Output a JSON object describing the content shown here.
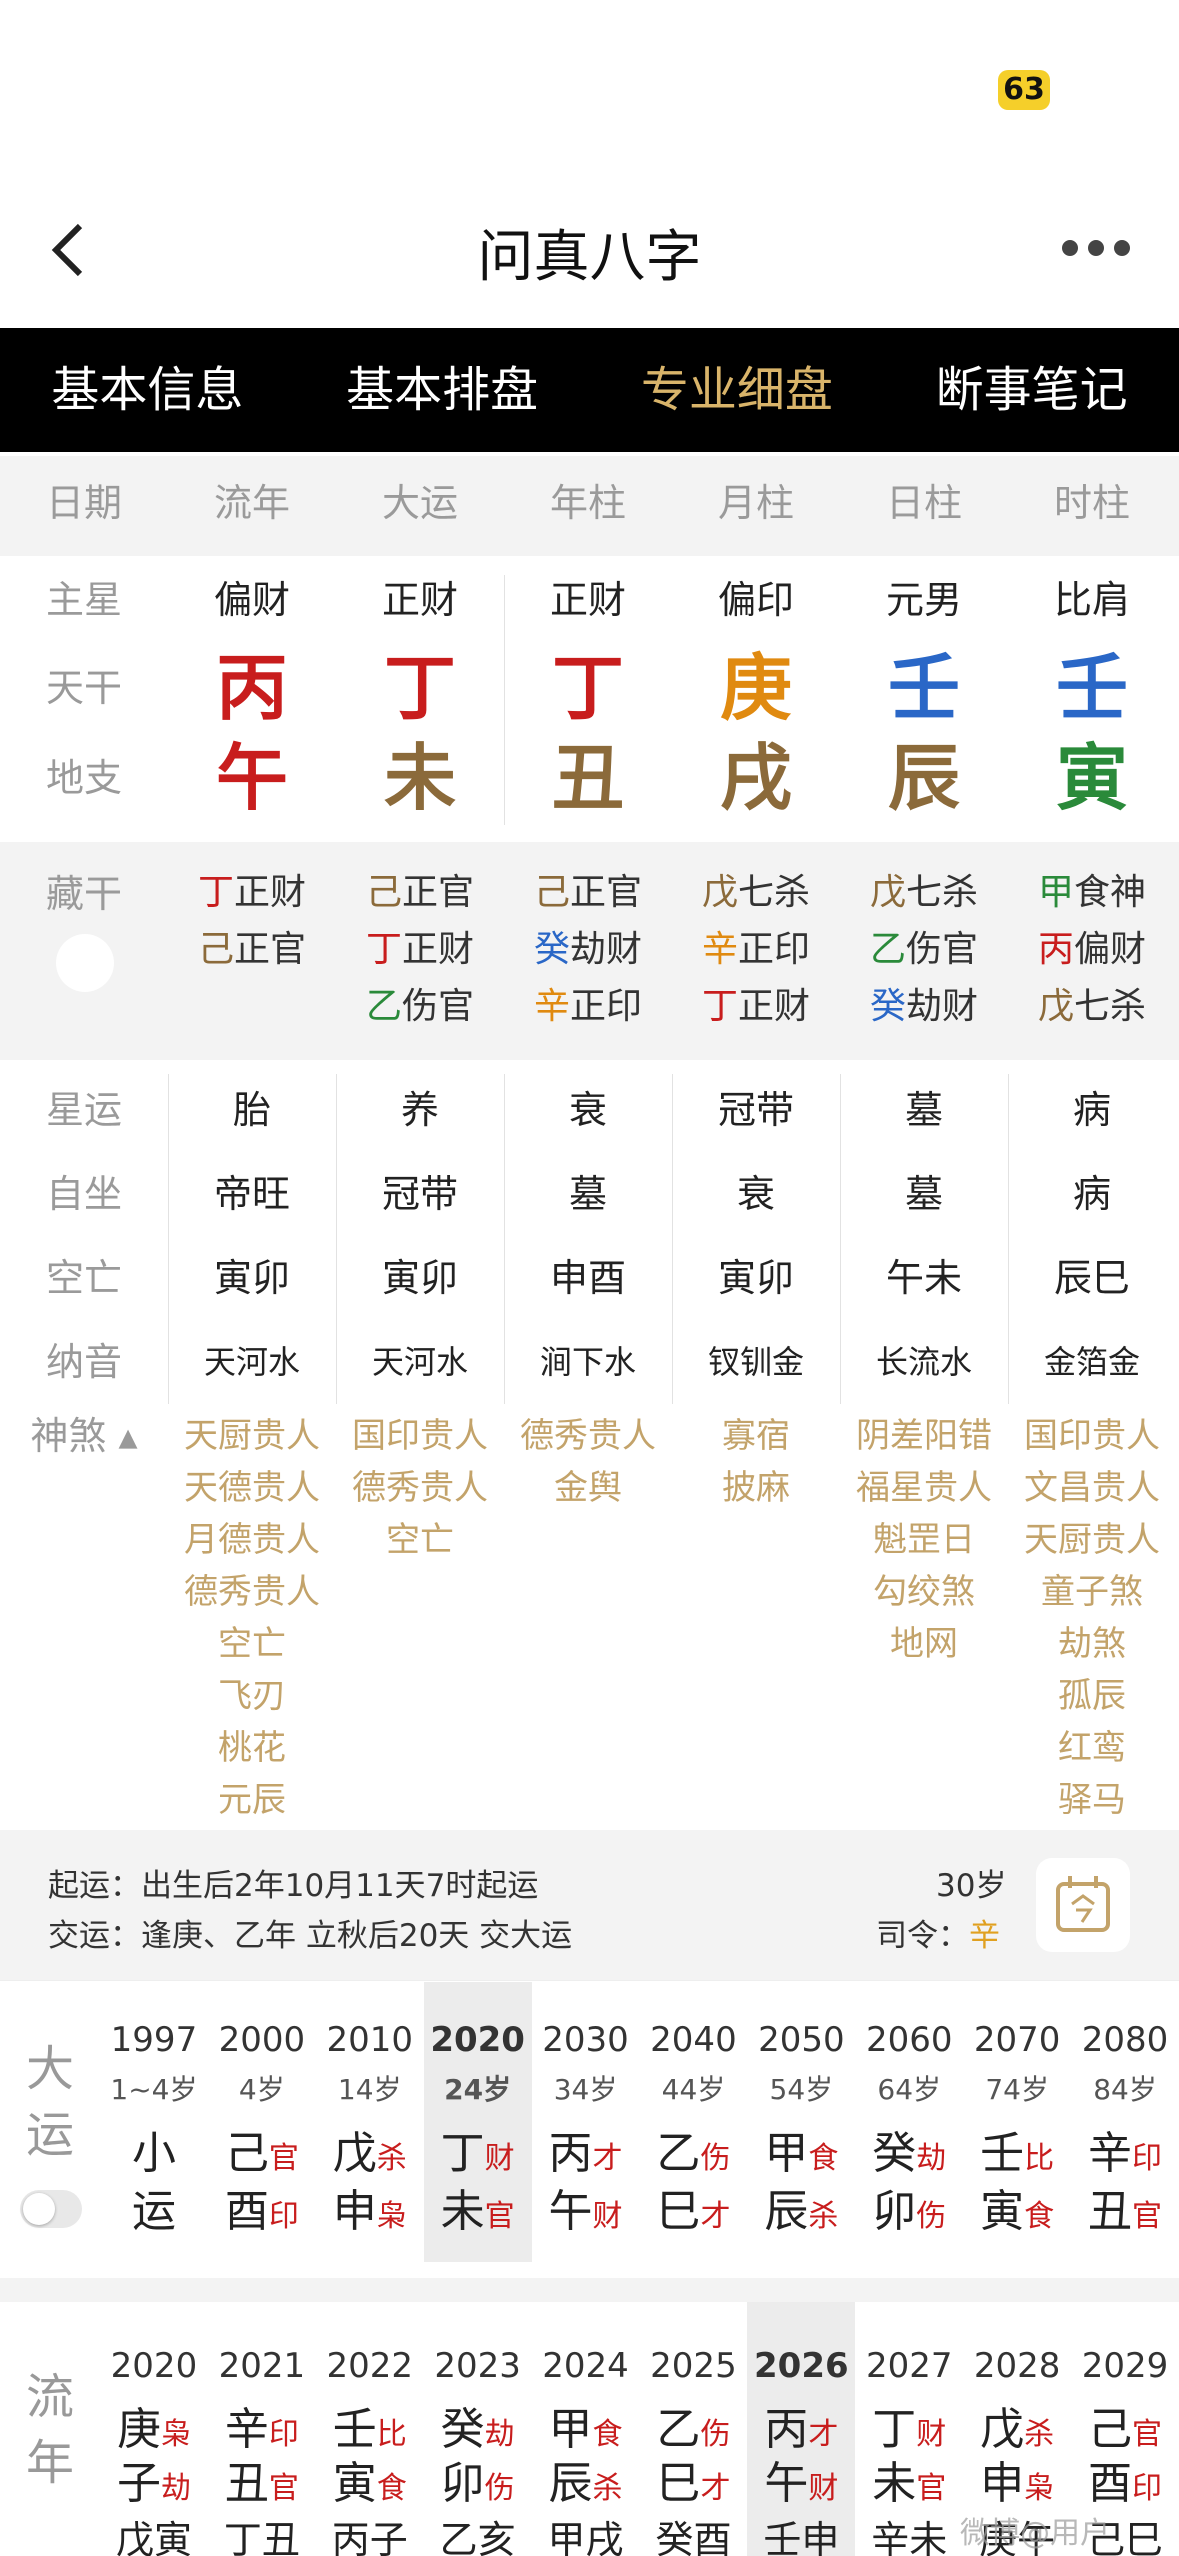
{
  "status": {
    "badge": "63"
  },
  "nav": {
    "title": "问真八字"
  },
  "tabs": [
    "基本信息",
    "基本排盘",
    "专业细盘",
    "断事笔记"
  ],
  "tabs_active": 2,
  "header": [
    "日期",
    "流年",
    "大运",
    "年柱",
    "月柱",
    "日柱",
    "时柱"
  ],
  "rows": {
    "zhuxing": {
      "label": "主星",
      "values": [
        "偏财",
        "正财",
        "正财",
        "偏印",
        "元男",
        "比肩"
      ]
    },
    "tiangan": {
      "label": "天干",
      "values": [
        "丙",
        "丁",
        "丁",
        "庚",
        "壬",
        "壬"
      ],
      "colors": [
        "#c81d1d",
        "#c81d1d",
        "#c81d1d",
        "#e08a10",
        "#2a67c7",
        "#2a67c7"
      ]
    },
    "dizhi": {
      "label": "地支",
      "values": [
        "午",
        "未",
        "丑",
        "戌",
        "辰",
        "寅"
      ],
      "colors": [
        "#c81d1d",
        "#8b6a3a",
        "#8b6a3a",
        "#8b6a3a",
        "#8b6a3a",
        "#2a8a3a"
      ]
    }
  },
  "canggan": {
    "label": "藏干",
    "cols": [
      [
        {
          "g": "丁",
          "c": "#c81d1d",
          "s": "正财"
        },
        {
          "g": "己",
          "c": "#8b6a3a",
          "s": "正官"
        }
      ],
      [
        {
          "g": "己",
          "c": "#8b6a3a",
          "s": "正官"
        },
        {
          "g": "丁",
          "c": "#c81d1d",
          "s": "正财"
        },
        {
          "g": "乙",
          "c": "#2a8a3a",
          "s": "伤官"
        }
      ],
      [
        {
          "g": "己",
          "c": "#8b6a3a",
          "s": "正官"
        },
        {
          "g": "癸",
          "c": "#2a67c7",
          "s": "劫财"
        },
        {
          "g": "辛",
          "c": "#e08a10",
          "s": "正印"
        }
      ],
      [
        {
          "g": "戊",
          "c": "#8b6a3a",
          "s": "七杀"
        },
        {
          "g": "辛",
          "c": "#e08a10",
          "s": "正印"
        },
        {
          "g": "丁",
          "c": "#c81d1d",
          "s": "正财"
        }
      ],
      [
        {
          "g": "戊",
          "c": "#8b6a3a",
          "s": "七杀"
        },
        {
          "g": "乙",
          "c": "#2a8a3a",
          "s": "伤官"
        },
        {
          "g": "癸",
          "c": "#2a67c7",
          "s": "劫财"
        }
      ],
      [
        {
          "g": "甲",
          "c": "#2a8a3a",
          "s": "食神"
        },
        {
          "g": "丙",
          "c": "#c81d1d",
          "s": "偏财"
        },
        {
          "g": "戊",
          "c": "#8b6a3a",
          "s": "七杀"
        }
      ]
    ]
  },
  "info_rows": [
    {
      "label": "星运",
      "values": [
        "胎",
        "养",
        "衰",
        "冠带",
        "墓",
        "病"
      ]
    },
    {
      "label": "自坐",
      "values": [
        "帝旺",
        "冠带",
        "墓",
        "衰",
        "墓",
        "病"
      ]
    },
    {
      "label": "空亡",
      "values": [
        "寅卯",
        "寅卯",
        "申酉",
        "寅卯",
        "午未",
        "辰巳"
      ]
    },
    {
      "label": "纳音",
      "values": [
        "天河水",
        "天河水",
        "涧下水",
        "钗钏金",
        "长流水",
        "金箔金"
      ]
    }
  ],
  "shensha": {
    "label": "神煞",
    "cols": [
      [
        "天厨贵人",
        "天德贵人",
        "月德贵人",
        "德秀贵人",
        "空亡",
        "飞刃",
        "桃花",
        "元辰"
      ],
      [
        "国印贵人",
        "德秀贵人",
        "空亡"
      ],
      [
        "德秀贵人",
        "金舆"
      ],
      [
        "寡宿",
        "披麻"
      ],
      [
        "阴差阳错",
        "福星贵人",
        "魁罡日",
        "勾绞煞",
        "地网"
      ],
      [
        "国印贵人",
        "文昌贵人",
        "天厨贵人",
        "童子煞",
        "劫煞",
        "孤辰",
        "红鸾",
        "驿马"
      ]
    ]
  },
  "qiyun": {
    "line1": "起运：出生后2年10月11天7时起运",
    "line2": "交运：逢庚、乙年 立秋后20天 交大运",
    "age": "30岁",
    "siling_label": "司令：",
    "siling_value": "辛"
  },
  "dayun": {
    "label": [
      "大",
      "运"
    ],
    "cols": [
      {
        "year": "1997",
        "age": "1~4岁",
        "g1": "小",
        "s1": "",
        "g2": "运",
        "s2": ""
      },
      {
        "year": "2000",
        "age": "4岁",
        "g1": "己",
        "s1": "官",
        "g2": "酉",
        "s2": "印"
      },
      {
        "year": "2010",
        "age": "14岁",
        "g1": "戊",
        "s1": "杀",
        "g2": "申",
        "s2": "枭"
      },
      {
        "year": "2020",
        "age": "24岁",
        "g1": "丁",
        "s1": "财",
        "g2": "未",
        "s2": "官"
      },
      {
        "year": "2030",
        "age": "34岁",
        "g1": "丙",
        "s1": "才",
        "g2": "午",
        "s2": "财"
      },
      {
        "year": "2040",
        "age": "44岁",
        "g1": "乙",
        "s1": "伤",
        "g2": "巳",
        "s2": "才"
      },
      {
        "year": "2050",
        "age": "54岁",
        "g1": "甲",
        "s1": "食",
        "g2": "辰",
        "s2": "杀"
      },
      {
        "year": "2060",
        "age": "64岁",
        "g1": "癸",
        "s1": "劫",
        "g2": "卯",
        "s2": "伤"
      },
      {
        "year": "2070",
        "age": "74岁",
        "g1": "壬",
        "s1": "比",
        "g2": "寅",
        "s2": "食"
      },
      {
        "year": "2080",
        "age": "84岁",
        "g1": "辛",
        "s1": "印",
        "g2": "丑",
        "s2": "官"
      }
    ],
    "active": 3
  },
  "liunian": {
    "label": [
      "流",
      "年"
    ],
    "cols": [
      {
        "year": "2020",
        "g1": "庚",
        "s1": "枭",
        "g2": "子",
        "s2": "劫",
        "x": "戊寅"
      },
      {
        "year": "2021",
        "g1": "辛",
        "s1": "印",
        "g2": "丑",
        "s2": "官",
        "x": "丁丑"
      },
      {
        "year": "2022",
        "g1": "壬",
        "s1": "比",
        "g2": "寅",
        "s2": "食",
        "x": "丙子"
      },
      {
        "year": "2023",
        "g1": "癸",
        "s1": "劫",
        "g2": "卯",
        "s2": "伤",
        "x": "乙亥"
      },
      {
        "year": "2024",
        "g1": "甲",
        "s1": "食",
        "g2": "辰",
        "s2": "杀",
        "x": "甲戌"
      },
      {
        "year": "2025",
        "g1": "乙",
        "s1": "伤",
        "g2": "巳",
        "s2": "才",
        "x": "癸酉"
      },
      {
        "year": "2026",
        "g1": "丙",
        "s1": "才",
        "g2": "午",
        "s2": "财",
        "x": "壬申"
      },
      {
        "year": "2027",
        "g1": "丁",
        "s1": "财",
        "g2": "未",
        "s2": "官",
        "x": "辛未"
      },
      {
        "year": "2028",
        "g1": "戊",
        "s1": "杀",
        "g2": "申",
        "s2": "枭",
        "x": "庚午"
      },
      {
        "year": "2029",
        "g1": "己",
        "s1": "官",
        "g2": "酉",
        "s2": "印",
        "x": "己巳"
      }
    ],
    "active": 6
  },
  "watermark": "微博@用户"
}
